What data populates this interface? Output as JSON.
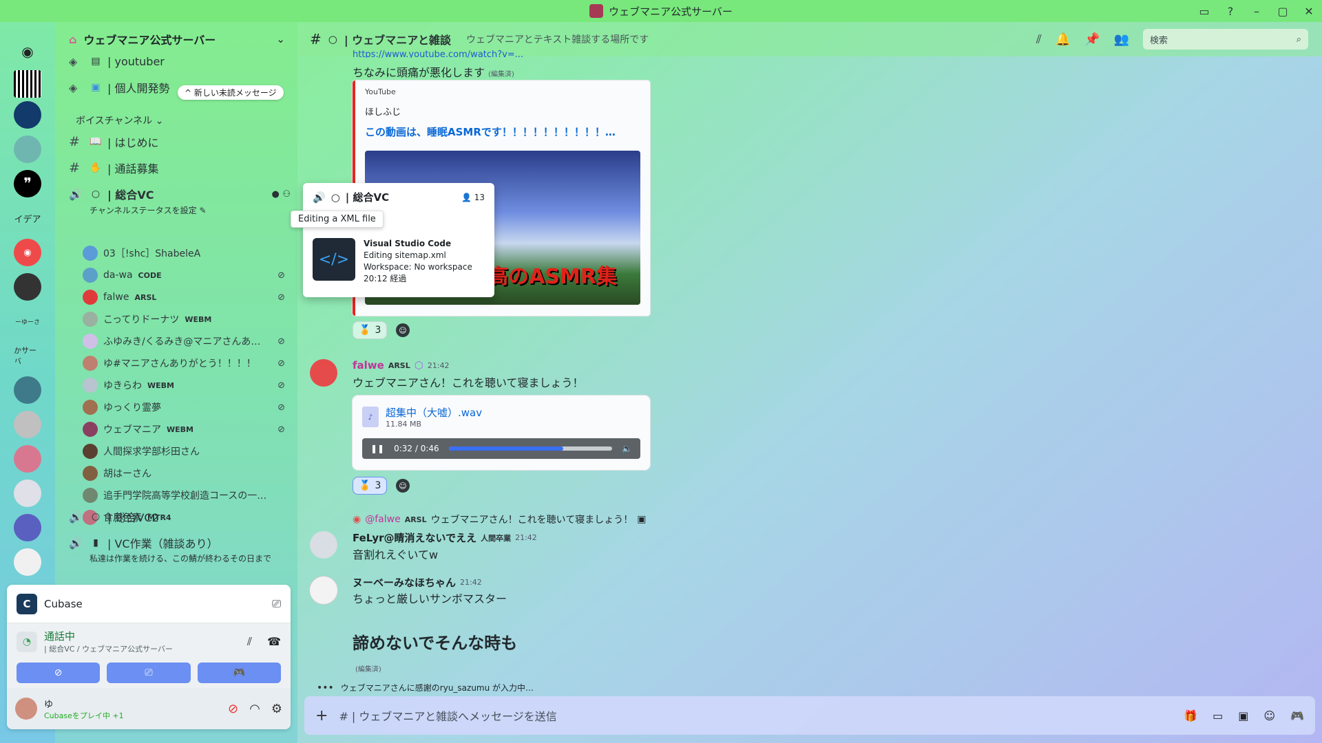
{
  "window": {
    "title": "ウェブマニア公式サーバー"
  },
  "rail": {
    "labels": [
      "イデア",
      "ーゆーさ",
      "かサーバ"
    ]
  },
  "server": {
    "name": "ウェブマニア公式サーバー"
  },
  "channels": {
    "unread_pill": "^ 新しい未読メッセージ",
    "youtuber": "| youtuber",
    "dev": "| 個人開発勢",
    "voice_category": "ボイスチャンネル ⌄",
    "intro": "| はじめに",
    "call_recruit": "| 通話募集",
    "general_vc": "| 総合VC",
    "status_set": "チャンネルステータスを設定 ✎",
    "general_vc2": "| 総合VC2",
    "work_vc": "| VC作業（雑談あり）",
    "work_vc_status": "私達は作業を続ける、この鯖が終わるその日まで"
  },
  "voice_users": [
    {
      "name": "03［!shc］ShabeleA",
      "badge": "",
      "muted": false,
      "color": "#5a9bd8"
    },
    {
      "name": "da-wa",
      "badge": "CODE",
      "muted": true,
      "color": "#5aa0c8"
    },
    {
      "name": "falwe",
      "badge": "ARSL",
      "muted": true,
      "color": "#e03b3b"
    },
    {
      "name": "こってりドーナツ",
      "badge": "WEBM",
      "muted": false,
      "color": "#9ab0a0"
    },
    {
      "name": "ふゆみき/くるみき@マニアさんあ…",
      "badge": "",
      "muted": true,
      "color": "#d0c0e8"
    },
    {
      "name": "ゆ#マニアさんありがとう！！！！",
      "badge": "",
      "muted": true,
      "color": "#c08070"
    },
    {
      "name": "ゆきらわ",
      "badge": "WEBM",
      "muted": true,
      "color": "#b8c4d0"
    },
    {
      "name": "ゆっくり霊夢",
      "badge": "",
      "muted": true,
      "color": "#a07050"
    },
    {
      "name": "ウェブマニア",
      "badge": "WEBM",
      "muted": true,
      "color": "#8a4060"
    },
    {
      "name": "人間探求学部杉田さん",
      "badge": "",
      "muted": false,
      "color": "#5a4030"
    },
    {
      "name": "胡はーさん",
      "badge": "",
      "muted": false,
      "color": "#806040"
    },
    {
      "name": "追手門学院高等学校創造コースの一…",
      "badge": "",
      "muted": false,
      "color": "#708870"
    },
    {
      "name": "食用色素",
      "badge": "MTR4",
      "muted": false,
      "color": "#c07080"
    }
  ],
  "panel": {
    "activity": "Cubase",
    "voice_status": "通話中",
    "voice_sub": "| 総合VC / ウェブマニア公式サーバー",
    "user_name": "ゆ",
    "user_status": "Cubaseをプレイ中 +1"
  },
  "header": {
    "channel": "| ウェブマニアと雑談",
    "topic": "ウェブマニアとテキスト雑談する場所です",
    "search_placeholder": "検索"
  },
  "messages": {
    "url_cut": "https://www.youtube.com/watch?v=...",
    "line1": "ちなみに頭痛が悪化します",
    "edited": "(編集済)",
    "embed": {
      "provider": "YouTube",
      "author": "ほしふじ",
      "title": "この動画は、睡眠ASMRです！！！！！！！！！！…",
      "thumb_text": "最高のASMR集"
    },
    "reaction_count": "3",
    "falwe": {
      "name": "falwe",
      "badge": "ARSL",
      "time": "21:42",
      "text": "ウェブマニアさん！これを聴いて寝ましょう！"
    },
    "audio": {
      "name": "超集中（大嘘）.wav",
      "size": "11.84 MB",
      "time": "0:32 / 0:46",
      "progress": 0.7
    },
    "reply_ref": {
      "name": "@falwe",
      "badge": "ARSL",
      "text": "ウェブマニアさん！これを聴いて寝ましょう！"
    },
    "felyr": {
      "name": "FeLyr@睛消えないでええ",
      "role": "人間卒業",
      "time": "21:42",
      "text": "音割れえぐいてw"
    },
    "nube": {
      "name": "ヌーベーみなほちゃん",
      "time": "21:42",
      "text": "ちょっと厳しいサンボマスター"
    },
    "big": "諦めないでそんな時も",
    "typing": "ウェブマニアさんに感謝のryu_sazumu が入力中…"
  },
  "compose": {
    "placeholder": "#  | ウェブマニアと雑談へメッセージを送信"
  },
  "popout": {
    "channel": "| 総合VC",
    "count": "13",
    "tooltip": "Editing a XML file",
    "app": "Visual Studio Code",
    "line1": "Editing sitemap.xml",
    "line2": "Workspace: No workspace",
    "elapsed": "20:12 経過"
  }
}
